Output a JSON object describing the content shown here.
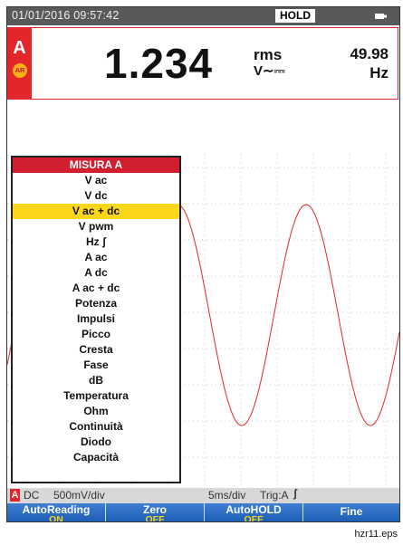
{
  "status_bar": {
    "datetime": "01/01/2016 09:57:42",
    "hold": "HOLD",
    "battery_icon": "battery-icon"
  },
  "readout": {
    "channel": "A",
    "channel_badge": "AR",
    "value": "1.234",
    "mode": "rms",
    "unit": "V∼⎓",
    "frequency": "49.98",
    "frequency_unit": "Hz",
    "accent_color": "#e3262b"
  },
  "menu": {
    "title": "MISURA A",
    "selected_index": 2,
    "items": [
      "V ac",
      "V dc",
      "V ac + dc",
      "V pwm",
      "Hz ʃ",
      "A ac",
      "A dc",
      "A ac + dc",
      "Potenza",
      "Impulsi",
      "Picco",
      "Cresta",
      "Fase",
      "dB",
      "Temperatura",
      "Ohm",
      "Continuità",
      "Diodo",
      "Capacità"
    ]
  },
  "trace": {
    "channel_marker": "A",
    "zero_marker": "–",
    "color": "#e3262b"
  },
  "scale_bar": {
    "channel": "A",
    "coupling": "DC",
    "volts_per_div": "500mV/div",
    "time_per_div": "5ms/div",
    "trigger": "Trig:A",
    "trigger_slope": "ʃ"
  },
  "softkeys": [
    {
      "label": "AutoReading",
      "state": "ON"
    },
    {
      "label": "Zero",
      "state": "OFF"
    },
    {
      "label": "AutoHOLD",
      "state": "OFF"
    },
    {
      "label": "Fine",
      "state": ""
    }
  ],
  "caption": "hzr11.eps"
}
